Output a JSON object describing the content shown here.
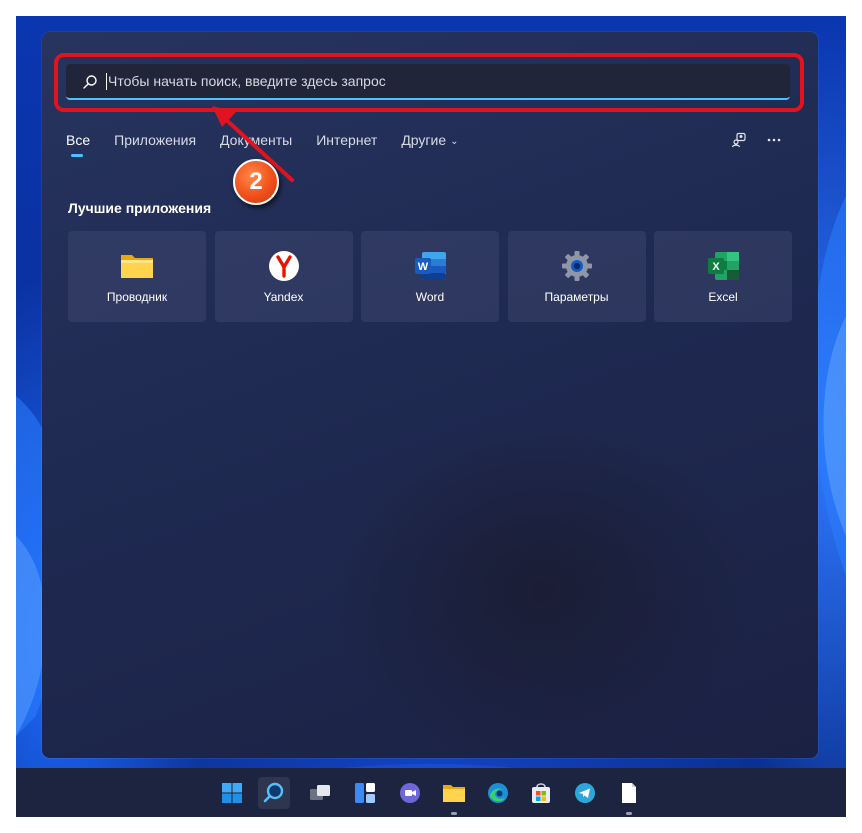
{
  "search": {
    "placeholder": "Чтобы начать поиск, введите здесь запрос",
    "value": ""
  },
  "tabs": [
    {
      "label": "Все",
      "active": true
    },
    {
      "label": "Приложения",
      "active": false
    },
    {
      "label": "Документы",
      "active": false
    },
    {
      "label": "Интернет",
      "active": false
    },
    {
      "label": "Другие",
      "active": false,
      "has_dropdown": true
    }
  ],
  "toolbar": {
    "icons": [
      "account-switch-icon",
      "more-options-icon"
    ]
  },
  "top_apps": {
    "title": "Лучшие приложения",
    "items": [
      {
        "label": "Проводник",
        "icon": "file-explorer-icon"
      },
      {
        "label": "Yandex",
        "icon": "yandex-icon"
      },
      {
        "label": "Word",
        "icon": "word-icon"
      },
      {
        "label": "Параметры",
        "icon": "settings-gear-icon"
      },
      {
        "label": "Excel",
        "icon": "excel-icon"
      }
    ]
  },
  "annotation": {
    "step_number": "2",
    "highlight_color": "#e0131f",
    "badge_color": "#f0501a"
  },
  "taskbar": {
    "icons": [
      "start-icon",
      "search-icon",
      "task-view-icon",
      "widgets-icon",
      "teams-chat-icon",
      "file-explorer-icon",
      "edge-icon",
      "store-icon",
      "telegram-icon",
      "document-icon"
    ]
  },
  "colors": {
    "accent": "#4cc2ff",
    "panel": "#1f2a52",
    "wallpaper": "#0a36b0"
  }
}
